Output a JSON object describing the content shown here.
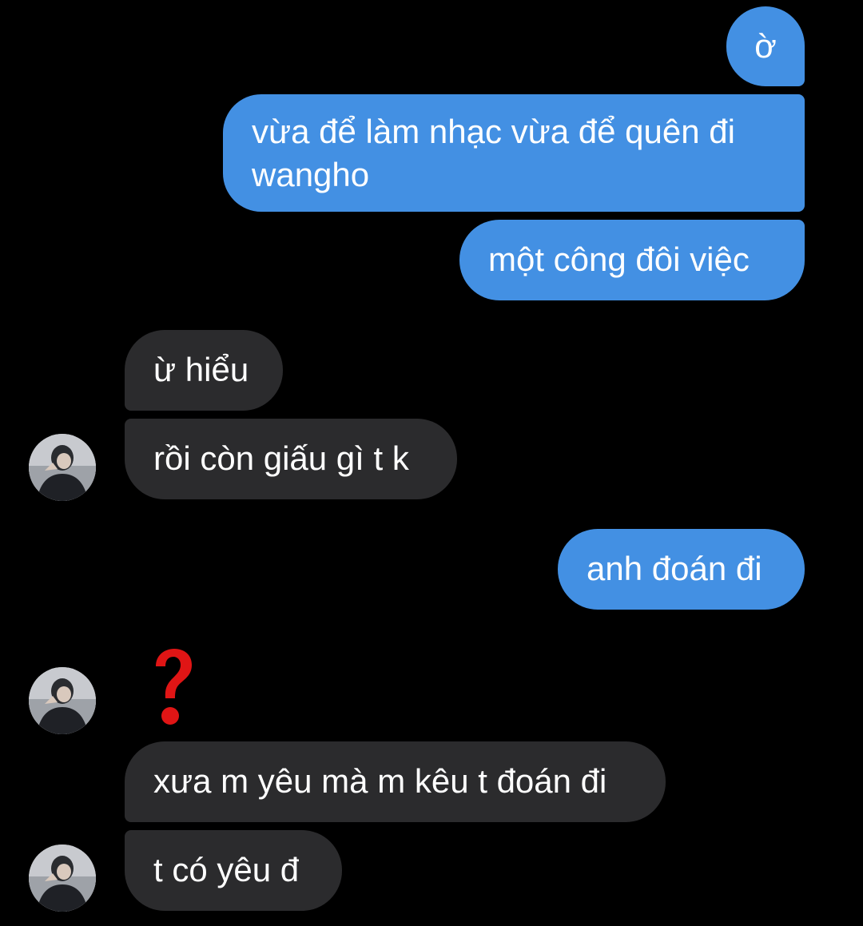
{
  "conversation": {
    "messages": [
      {
        "sender": "me",
        "text": "ờ"
      },
      {
        "sender": "me",
        "text": "vừa để làm nhạc vừa để quên đi\nwangho"
      },
      {
        "sender": "me",
        "text": "một công đôi việc"
      },
      {
        "sender": "them",
        "text": "ừ hiểu"
      },
      {
        "sender": "them",
        "text": "rồi còn giấu gì t k"
      },
      {
        "sender": "me",
        "text": "anh đoán đi"
      },
      {
        "sender": "them",
        "text": "xưa m yêu mà m kêu t đoán đi"
      },
      {
        "sender": "them",
        "text": "t có yêu đ"
      }
    ],
    "reaction": {
      "type": "question-mark",
      "color": "#E01515"
    }
  },
  "colors": {
    "background": "#000000",
    "sent_bubble": "#4390E3",
    "received_bubble": "#2B2B2D",
    "text": "#FFFFFF"
  }
}
